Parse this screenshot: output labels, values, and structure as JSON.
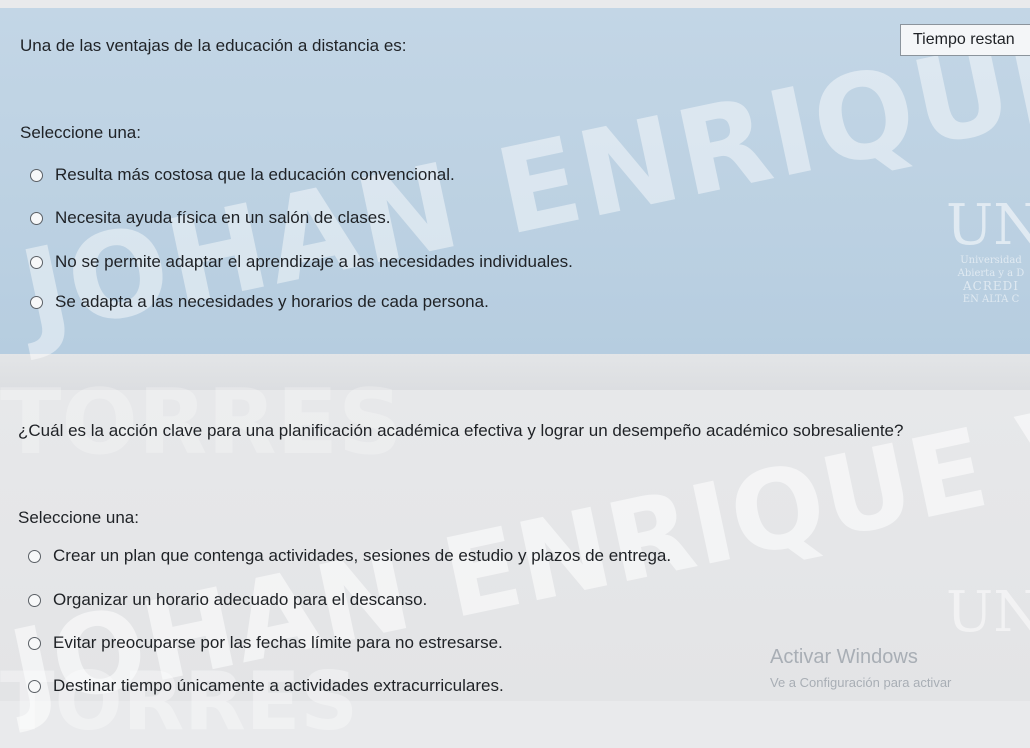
{
  "timer": {
    "label": "Tiempo restan"
  },
  "watermark": {
    "line1": "JOHAN ENRIQUE VILLAFANE",
    "line2": "TORRES"
  },
  "logo": {
    "mark": "UN",
    "line1": "Universidad",
    "line2": "Abierta y a D",
    "line3": "ACREDI",
    "line4": "EN ALTA C"
  },
  "question1": {
    "text": "Una de las ventajas de la educación a distancia es:",
    "prompt": "Seleccione una:",
    "options": [
      "Resulta más costosa que la educación convencional.",
      "Necesita ayuda física en un salón de clases.",
      "No se permite adaptar el aprendizaje a las necesidades individuales.",
      "Se adapta a las necesidades y horarios de cada persona."
    ]
  },
  "question2": {
    "text": "¿Cuál es la acción clave para una planificación académica efectiva y lograr un desempeño académico sobresaliente?",
    "prompt": "Seleccione una:",
    "options": [
      "Crear un plan que contenga actividades, sesiones de estudio y plazos de entrega.",
      "Organizar un horario adecuado para el descanso.",
      "Evitar preocuparse por las fechas límite para no estresarse.",
      "Destinar tiempo únicamente a actividades extracurriculares."
    ]
  },
  "windows": {
    "title": "Activar Windows",
    "subtitle": "Ve a Configuración para activar"
  }
}
